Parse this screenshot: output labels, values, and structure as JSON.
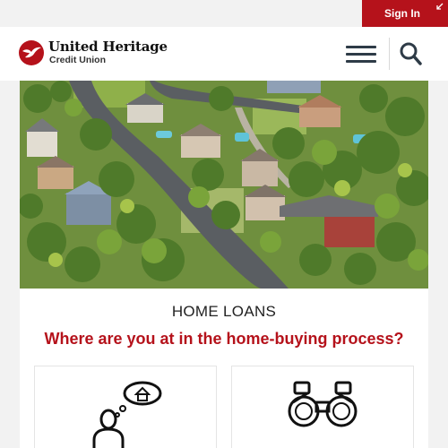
{
  "header": {
    "signin_label": "Sign In",
    "logo_name": "United Heritage",
    "logo_sub": "Credit Union",
    "menu_icon": "hamburger-menu-icon",
    "search_icon": "search-icon"
  },
  "hero": {
    "alt": "aerial-neighborhood-photo"
  },
  "section": {
    "title": "HOME LOANS",
    "subtitle": "Where are you at in the home-buying process?"
  },
  "cards": [
    {
      "icon": "person-thinking-home-icon"
    },
    {
      "icon": "binoculars-icon"
    }
  ],
  "colors": {
    "brand_red": "#b5121b",
    "nav_icon": "#2e3b47",
    "background": "#f2f2f2"
  }
}
